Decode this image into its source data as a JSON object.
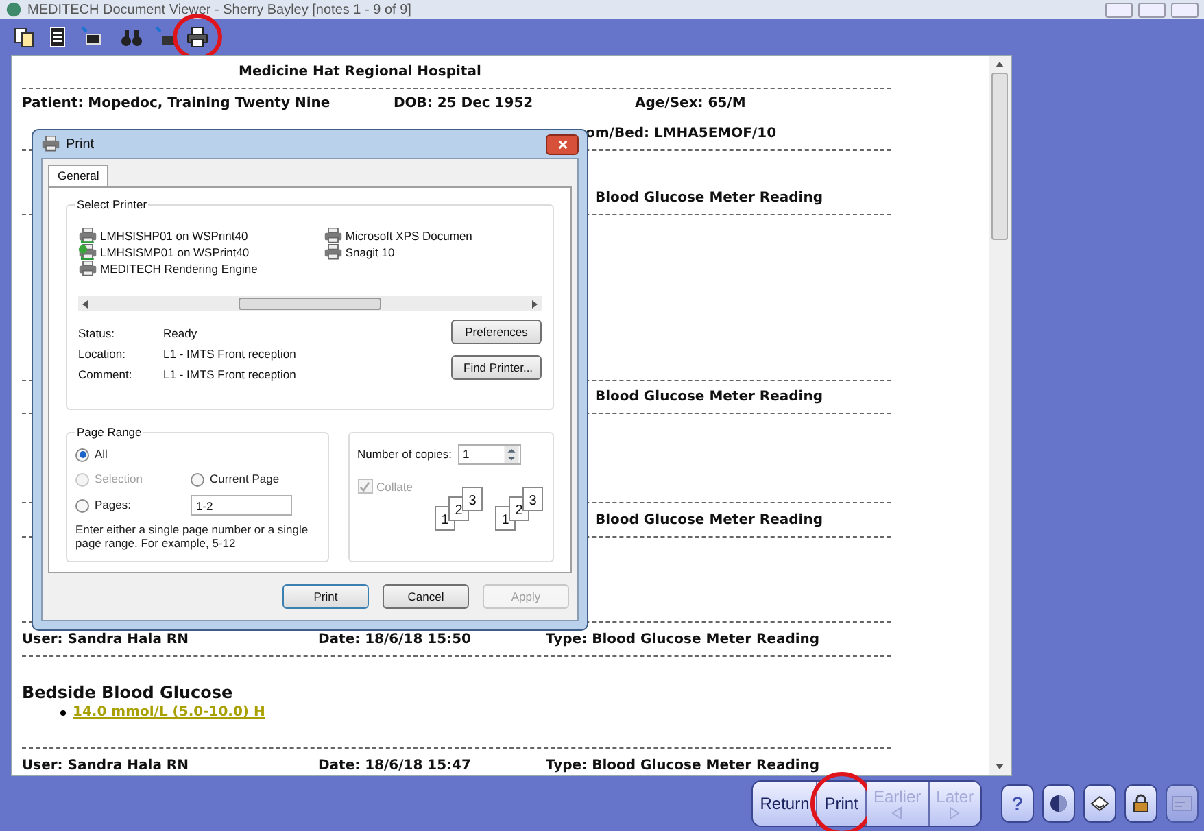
{
  "window": {
    "title": "MEDITECH Document Viewer - Sherry Bayley [notes 1 - 9 of 9]"
  },
  "toolbar": [
    {
      "highlighted": false
    },
    {
      "highlighted": false
    },
    {
      "highlighted": false
    },
    {
      "highlighted": false
    },
    {
      "highlighted": false
    },
    {
      "highlighted": true
    }
  ],
  "document": {
    "hospital": "Medicine Hat Regional Hospital",
    "patient": "Patient: Mopedoc, Training Twenty Nine",
    "dob": "DOB: 25 Dec 1952",
    "age_sex": "Age/Sex:  65/M",
    "room_bed": "om/Bed:  LMHA5EMOF/10",
    "notes": [
      {
        "type": "Blood Glucose Meter Reading"
      },
      {
        "type": "Blood Glucose Meter Reading"
      },
      {
        "type": "Blood Glucose Meter Reading"
      },
      {
        "user": "User: Sandra Hala RN",
        "date": "Date: 18/6/18 15:50",
        "type": "Type: Blood Glucose Meter Reading",
        "heading": "Bedside Blood Glucose",
        "result": "14.0 mmol/L (5.0-10.0) H"
      },
      {
        "user": "User: Sandra Hala RN",
        "date": "Date: 18/6/18 15:47",
        "type": "Type: Blood Glucose Meter Reading"
      }
    ]
  },
  "dialog": {
    "title": "Print",
    "tabs": [
      {
        "label": "General",
        "selected": true
      }
    ],
    "select_printer": {
      "label": "Select Printer",
      "printers": [
        {
          "name": "LMHSISHP01 on WSPrint40",
          "kind": "network",
          "default": false
        },
        {
          "name": "LMHSISMP01 on WSPrint40",
          "kind": "network",
          "default": true
        },
        {
          "name": "MEDITECH Rendering Engine",
          "kind": "local",
          "default": false
        },
        {
          "name": "Microsoft XPS Documen",
          "kind": "local",
          "default": false
        },
        {
          "name": "Snagit 10",
          "kind": "local",
          "default": false
        }
      ],
      "info": [
        {
          "label": "Status:",
          "value": "Ready"
        },
        {
          "label": "Location:",
          "value": "L1 - IMTS Front reception"
        },
        {
          "label": "Comment:",
          "value": "L1 - IMTS Front reception"
        }
      ],
      "buttons": [
        "Preferences",
        "Find Printer..."
      ]
    },
    "page_range": {
      "label": "Page Range",
      "options": [
        {
          "label": "All",
          "selected": true,
          "disabled": false
        },
        {
          "label": "Selection",
          "selected": false,
          "disabled": true
        },
        {
          "label": "Current Page",
          "selected": false,
          "disabled": false
        },
        {
          "label": "Pages:",
          "selected": false,
          "disabled": false
        }
      ],
      "pages_value": "1-2",
      "hint": "Enter either a single page number or a single page range.  For example, 5-12"
    },
    "copies": {
      "label": "Number of copies:",
      "value": "1",
      "collate": {
        "label": "Collate",
        "checked": true,
        "disabled": true
      },
      "collate_groups": [
        [
          "1",
          "2",
          "3"
        ],
        [
          "1",
          "2",
          "3"
        ]
      ]
    },
    "buttons": [
      {
        "label": "Print",
        "disabled": false,
        "default": true
      },
      {
        "label": "Cancel",
        "disabled": false,
        "default": false
      },
      {
        "label": "Apply",
        "disabled": true,
        "default": false
      }
    ]
  },
  "nav_buttons": [
    {
      "label": "Return",
      "disabled": false,
      "highlighted": false,
      "kind": "plain"
    },
    {
      "label": "Print",
      "disabled": false,
      "highlighted": true,
      "kind": "plain"
    },
    {
      "label": "Earlier",
      "disabled": true,
      "highlighted": false,
      "kind": "back"
    },
    {
      "label": "Later",
      "disabled": true,
      "highlighted": false,
      "kind": "forward"
    }
  ],
  "help_label": "?"
}
